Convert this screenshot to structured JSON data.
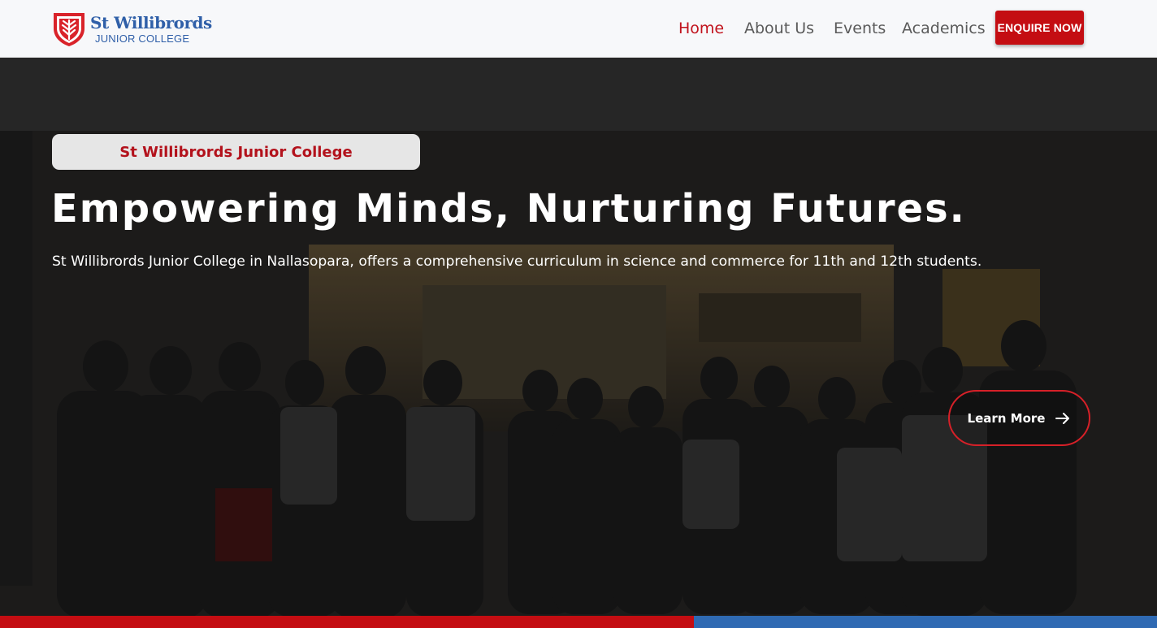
{
  "header": {
    "logo_title": "St Willibrords",
    "logo_subtitle": "JUNIOR COLLEGE",
    "logo_icon": "shield-icon",
    "nav": [
      {
        "label": "Home",
        "active": true
      },
      {
        "label": "About Us",
        "active": false
      },
      {
        "label": "Events",
        "active": false
      },
      {
        "label": "Academics",
        "active": false
      }
    ],
    "cta_label": "ENQUIRE NOW"
  },
  "hero": {
    "tag": "St Willibrords Junior College",
    "headline": "Empowering Minds, Nurturing Futures.",
    "subtext": "St Willibrords Junior College in Nallasopara, offers a comprehensive curriculum in science and commerce for 11th and 12th students.",
    "button_label": "Learn More",
    "button_icon": "arrow-right-icon",
    "background": "group-photo-of-students"
  },
  "colors": {
    "accent_red": "#c40d12",
    "brand_blue": "#2f5fa8",
    "bar_blue": "#2f6ab3",
    "nav_active": "#c1121c",
    "nav_text": "#5a5a5a"
  }
}
